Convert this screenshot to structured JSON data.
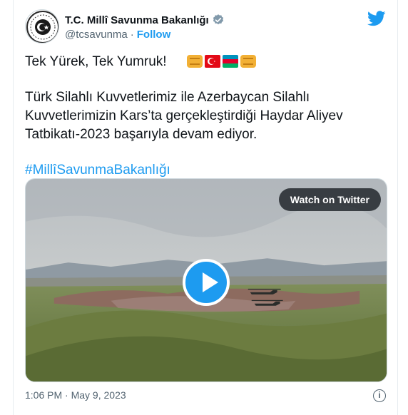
{
  "account": {
    "display_name": "T.C. Millî Savunma Bakanlığı",
    "handle": "@tcsavunma",
    "separator": "·",
    "follow_label": "Follow",
    "avatar_icon": "ministry-emblem-icon",
    "verified_icon": "verified-badge-icon"
  },
  "brand": {
    "logo_icon": "twitter-bird-icon",
    "color": "#1d9bf0"
  },
  "tweet": {
    "line1": "Tek Yürek, Tek Yumruk!",
    "body_lines": [
      "Türk Silahlı Kuvvetlerimiz ile Azerbaycan Silahlı",
      "Kuvvetlerimizin Kars’ta gerçekleştirdiği Haydar Aliyev",
      "Tatbikatı-2023 başarıyla devam ediyor."
    ],
    "hashtag": "#MillîSavunmaBakanlığı",
    "emojis": [
      "fist-icon",
      "turkey-flag-icon",
      "azerbaijan-flag-icon",
      "fist-icon"
    ]
  },
  "media": {
    "watch_label": "Watch on Twitter",
    "play_icon": "play-icon"
  },
  "footer": {
    "time": "1:06 PM",
    "separator": "·",
    "date": "May 9, 2023",
    "info_icon": "info-icon",
    "info_glyph": "i"
  }
}
